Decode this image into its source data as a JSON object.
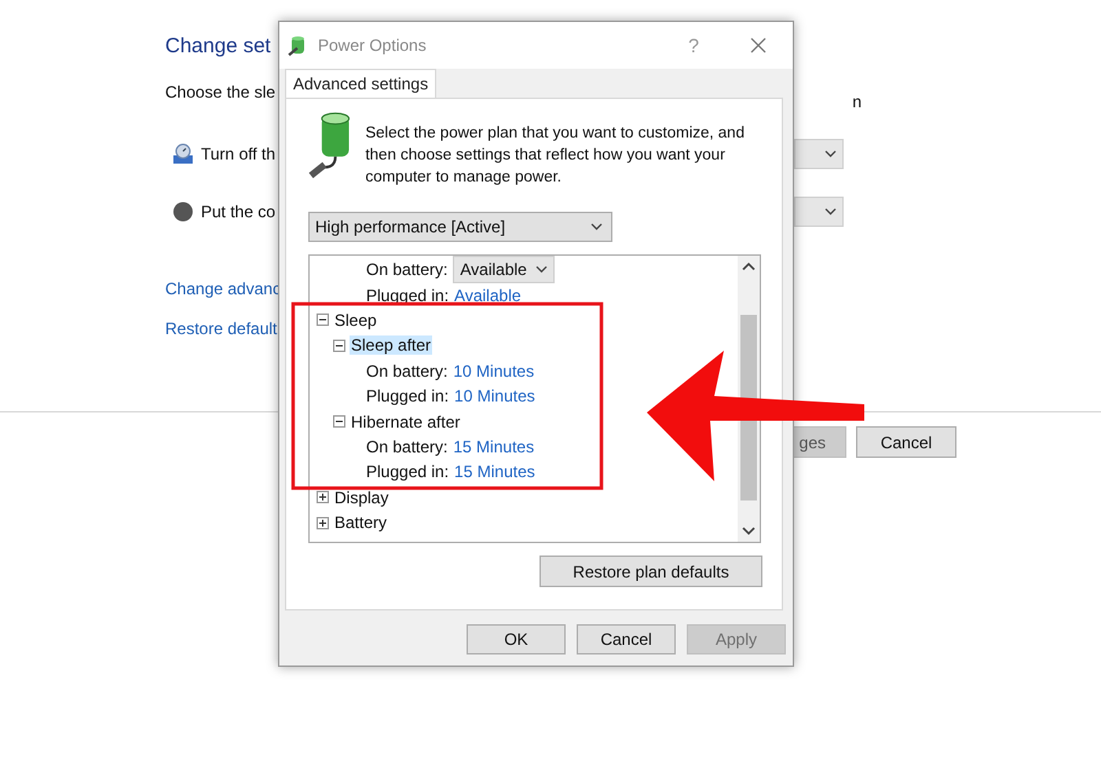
{
  "background": {
    "heading": "Change set",
    "subtitle": "Choose the sle",
    "fragment": "n",
    "settings": [
      {
        "kind": "display",
        "label": "Turn off th"
      },
      {
        "kind": "sleep",
        "label": "Put the co"
      }
    ],
    "links": [
      "Change advanc",
      "Restore default"
    ],
    "buttons": [
      {
        "label": "ges",
        "disabled": true
      },
      {
        "label": "Cancel",
        "disabled": false
      }
    ]
  },
  "dialog": {
    "title": "Power Options",
    "help": "?",
    "tabs": [
      {
        "label": "Advanced settings",
        "selected": true
      }
    ],
    "description": "Select the power plan that you want to customize, and then choose settings that reflect how you want your computer to manage power.",
    "plan": "High performance [Active]",
    "tree": {
      "partial_rows": [
        {
          "label": "On battery:",
          "value": "Available",
          "editing": true
        },
        {
          "label": "Plugged in:",
          "value": "Available",
          "editing": false
        }
      ],
      "items": [
        {
          "label": "Sleep",
          "expanded": true,
          "selected": false,
          "children": [
            {
              "label": "Sleep after",
              "expanded": true,
              "selected": true,
              "settings": [
                {
                  "label": "On battery:",
                  "value": "10 Minutes",
                  "editing": false
                },
                {
                  "label": "Plugged in:",
                  "value": "10 Minutes",
                  "editing": false
                }
              ]
            },
            {
              "label": "Hibernate after",
              "expanded": true,
              "selected": false,
              "settings": [
                {
                  "label": "On battery:",
                  "value": "15 Minutes",
                  "editing": false
                },
                {
                  "label": "Plugged in:",
                  "value": "15 Minutes",
                  "editing": false
                }
              ]
            }
          ]
        },
        {
          "label": "Display",
          "expanded": false,
          "selected": false
        },
        {
          "label": "Battery",
          "expanded": false,
          "selected": false
        }
      ]
    },
    "restore": "Restore plan defaults",
    "buttons": [
      {
        "label": "OK",
        "disabled": false
      },
      {
        "label": "Cancel",
        "disabled": false
      },
      {
        "label": "Apply",
        "disabled": true
      }
    ]
  }
}
